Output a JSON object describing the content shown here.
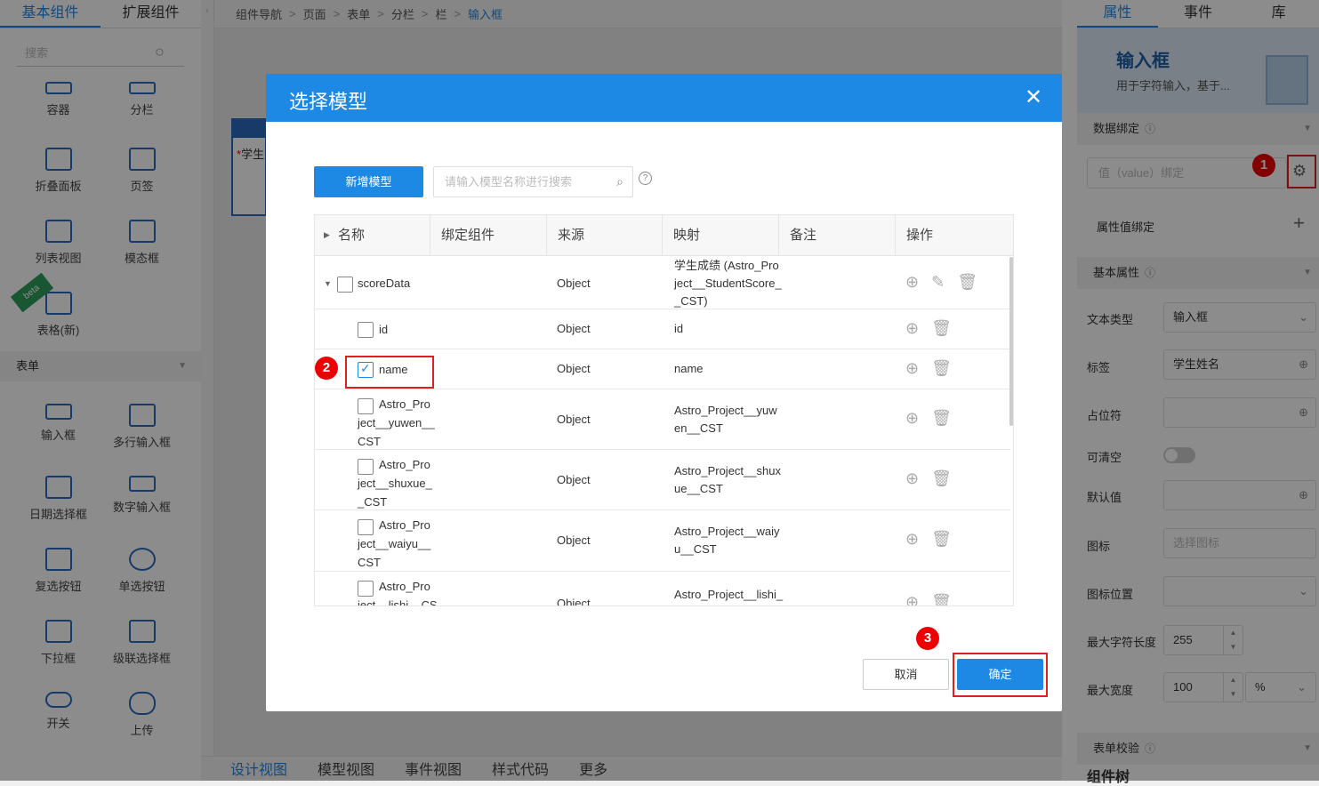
{
  "left_tabs": [
    "基本组件",
    "扩展组件"
  ],
  "left_search_placeholder": "搜索",
  "components": [
    "容器",
    "分栏",
    "折叠面板",
    "页签",
    "列表视图",
    "模态框",
    "表格(新)"
  ],
  "beta": "beta",
  "form_section": "表单",
  "form_components": [
    "输入框",
    "多行输入框",
    "日期选择框",
    "数字输入框",
    "复选按钮",
    "单选按钮",
    "下拉框",
    "级联选择框",
    "开关",
    "上传"
  ],
  "breadcrumb": [
    "组件导航",
    "页面",
    "表单",
    "分栏",
    "栏",
    "输入框"
  ],
  "canvas_widget": {
    "label": "学生",
    "required_mark": "*"
  },
  "bottom_tabs": [
    "设计视图",
    "模型视图",
    "事件视图",
    "样式代码",
    "更多"
  ],
  "right_tabs": [
    "属性",
    "事件",
    "库"
  ],
  "right_header": {
    "title": "输入框",
    "desc": "用于字符输入，基于..."
  },
  "right": {
    "data_binding": "数据绑定",
    "bind_placeholder": "值（value）绑定",
    "attr_binding": "属性值绑定",
    "basic_props": "基本属性",
    "text_type_label": "文本类型",
    "text_type_value": "输入框",
    "label_label": "标签",
    "label_value": "学生姓名",
    "placeholder_label": "占位符",
    "clearable_label": "可清空",
    "default_label": "默认值",
    "icon_label": "图标",
    "icon_placeholder": "选择图标",
    "icon_pos_label": "图标位置",
    "maxlen_label": "最大字符长度",
    "maxlen_value": "255",
    "maxwidth_label": "最大宽度",
    "maxwidth_value": "100",
    "maxwidth_unit": "%",
    "form_validation": "表单校验",
    "component_tree": "组件树"
  },
  "modal": {
    "title": "选择模型",
    "add_button": "新增模型",
    "search_placeholder": "请输入模型名称进行搜索",
    "headers": [
      "名称",
      "绑定组件",
      "来源",
      "映射",
      "备注",
      "操作"
    ],
    "rows": [
      {
        "name": "scoreData",
        "source": "Object",
        "mapping": "学生成绩 (Astro_Pro\nject__StudentScore_\n_CST)"
      },
      {
        "name": "id",
        "source": "Object",
        "mapping": "id"
      },
      {
        "name": "name",
        "source": "Object",
        "mapping": "name"
      },
      {
        "name": "Astro_Pro\nject__yuwen__\nCST",
        "source": "Object",
        "mapping": "Astro_Project__yuw\nen__CST"
      },
      {
        "name": "Astro_Pro\nject__shuxue_\n_CST",
        "source": "Object",
        "mapping": "Astro_Project__shux\nue__CST"
      },
      {
        "name": "Astro_Pro\nject__waiyu__\nCST",
        "source": "Object",
        "mapping": "Astro_Project__waiy\nu__CST"
      },
      {
        "name": "Astro_Pro\nject__lishi__CS",
        "source": "Object",
        "mapping": "Astro_Project__lishi_"
      }
    ],
    "cancel": "取消",
    "ok": "确定"
  },
  "badges": [
    "1",
    "2",
    "3"
  ],
  "colors": {
    "primary": "#1e88e5",
    "highlight": "#e02020"
  }
}
